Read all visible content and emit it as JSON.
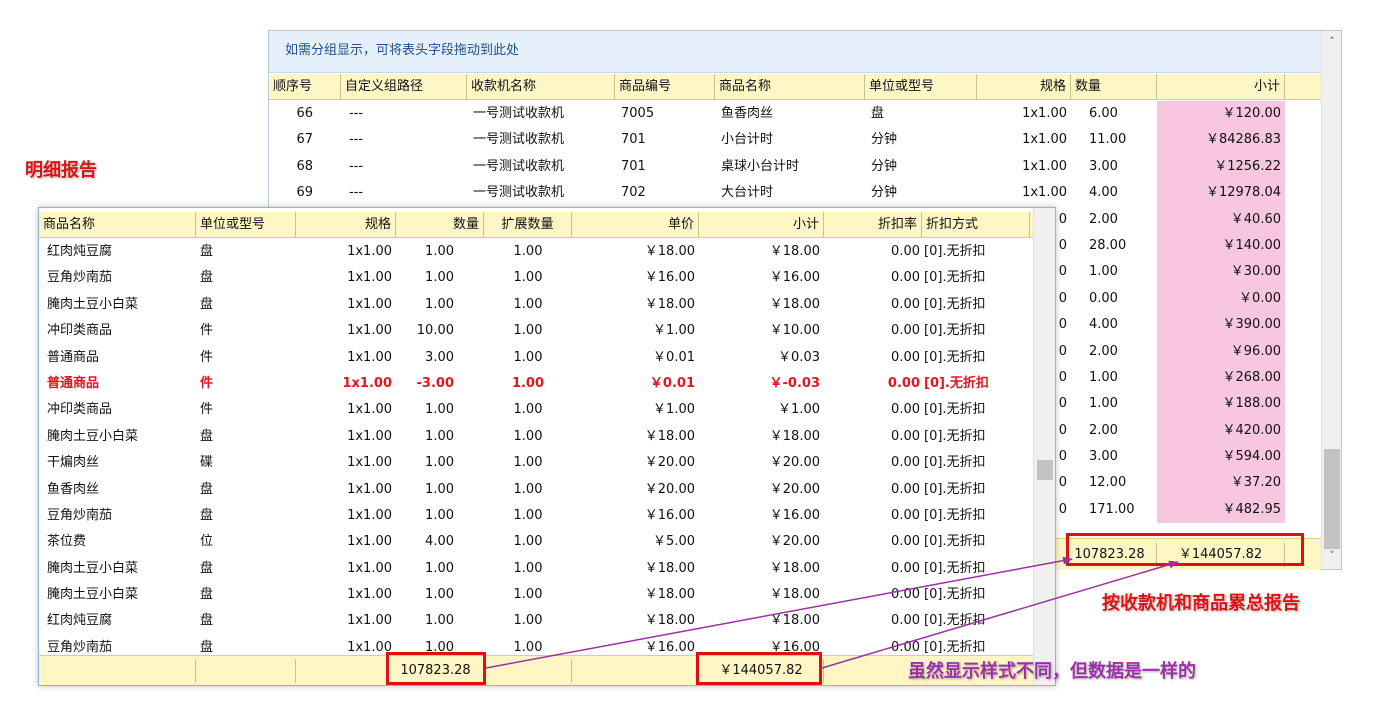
{
  "annotations": {
    "detail_report": "明细报告",
    "summary_report": "按收款机和商品累总报告",
    "same_data_note": "虽然显示样式不同，但数据是一样的"
  },
  "summary_window": {
    "group_hint": "如需分组显示，可将表头字段拖动到此处",
    "columns": [
      "顺序号",
      "自定义组路径",
      "收款机名称",
      "商品编号",
      "商品名称",
      "单位或型号",
      "规格",
      "数量",
      "小计"
    ],
    "rows": [
      {
        "seq": "66",
        "path": "---",
        "pos": "一号测试收款机",
        "code": "7005",
        "name": "鱼香肉丝",
        "unit": "盘",
        "spec": "1x1.00",
        "qty": "6.00",
        "subtotal": "￥120.00"
      },
      {
        "seq": "67",
        "path": "---",
        "pos": "一号测试收款机",
        "code": "701",
        "name": "小台计时",
        "unit": "分钟",
        "spec": "1x1.00",
        "qty": "11.00",
        "subtotal": "￥84286.83"
      },
      {
        "seq": "68",
        "path": "---",
        "pos": "一号测试收款机",
        "code": "701",
        "name": "桌球小台计时",
        "unit": "分钟",
        "spec": "1x1.00",
        "qty": "3.00",
        "subtotal": "￥1256.22"
      },
      {
        "seq": "69",
        "path": "---",
        "pos": "一号测试收款机",
        "code": "702",
        "name": "大台计时",
        "unit": "分钟",
        "spec": "1x1.00",
        "qty": "4.00",
        "subtotal": "￥12978.04"
      },
      {
        "seq": "",
        "path": "",
        "pos": "",
        "code": "",
        "name": "",
        "unit": "",
        "spec": "0",
        "qty": "2.00",
        "subtotal": "￥40.60"
      },
      {
        "seq": "",
        "path": "",
        "pos": "",
        "code": "",
        "name": "",
        "unit": "",
        "spec": "0",
        "qty": "28.00",
        "subtotal": "￥140.00"
      },
      {
        "seq": "",
        "path": "",
        "pos": "",
        "code": "",
        "name": "",
        "unit": "",
        "spec": "0",
        "qty": "1.00",
        "subtotal": "￥30.00"
      },
      {
        "seq": "",
        "path": "",
        "pos": "",
        "code": "",
        "name": "",
        "unit": "",
        "spec": "0",
        "qty": "0.00",
        "subtotal": "￥0.00"
      },
      {
        "seq": "",
        "path": "",
        "pos": "",
        "code": "",
        "name": "",
        "unit": "",
        "spec": "0",
        "qty": "4.00",
        "subtotal": "￥390.00"
      },
      {
        "seq": "",
        "path": "",
        "pos": "",
        "code": "",
        "name": "",
        "unit": "",
        "spec": "0",
        "qty": "2.00",
        "subtotal": "￥96.00"
      },
      {
        "seq": "",
        "path": "",
        "pos": "",
        "code": "",
        "name": "",
        "unit": "",
        "spec": "0",
        "qty": "1.00",
        "subtotal": "￥268.00"
      },
      {
        "seq": "",
        "path": "",
        "pos": "",
        "code": "",
        "name": "",
        "unit": "",
        "spec": "0",
        "qty": "1.00",
        "subtotal": "￥188.00"
      },
      {
        "seq": "",
        "path": "",
        "pos": "",
        "code": "",
        "name": "",
        "unit": "",
        "spec": "0",
        "qty": "2.00",
        "subtotal": "￥420.00"
      },
      {
        "seq": "",
        "path": "",
        "pos": "",
        "code": "",
        "name": "",
        "unit": "",
        "spec": "0",
        "qty": "3.00",
        "subtotal": "￥594.00"
      },
      {
        "seq": "",
        "path": "",
        "pos": "",
        "code": "",
        "name": "",
        "unit": "",
        "spec": "0",
        "qty": "12.00",
        "subtotal": "￥37.20"
      },
      {
        "seq": "",
        "path": "",
        "pos": "",
        "code": "",
        "name": "",
        "unit": "",
        "spec": "0",
        "qty": "171.00",
        "subtotal": "￥482.95"
      }
    ],
    "totals": {
      "qty": "107823.28",
      "subtotal": "￥144057.82"
    }
  },
  "detail_window": {
    "columns": [
      "商品名称",
      "单位或型号",
      "规格",
      "数量",
      "扩展数量",
      "单价",
      "小计",
      "折扣率",
      "折扣方式"
    ],
    "rows": [
      {
        "name": "红肉炖豆腐",
        "unit": "盘",
        "spec": "1x1.00",
        "qty": "1.00",
        "ext": "1.00",
        "price": "￥18.00",
        "subtotal": "￥18.00",
        "rate": "0.00",
        "method": "[0].无折扣"
      },
      {
        "name": "豆角炒南茄",
        "unit": "盘",
        "spec": "1x1.00",
        "qty": "1.00",
        "ext": "1.00",
        "price": "￥16.00",
        "subtotal": "￥16.00",
        "rate": "0.00",
        "method": "[0].无折扣"
      },
      {
        "name": "腌肉土豆小白菜",
        "unit": "盘",
        "spec": "1x1.00",
        "qty": "1.00",
        "ext": "1.00",
        "price": "￥18.00",
        "subtotal": "￥18.00",
        "rate": "0.00",
        "method": "[0].无折扣"
      },
      {
        "name": "冲印类商品",
        "unit": "件",
        "spec": "1x1.00",
        "qty": "10.00",
        "ext": "1.00",
        "price": "￥1.00",
        "subtotal": "￥10.00",
        "rate": "0.00",
        "method": "[0].无折扣"
      },
      {
        "name": "普通商品",
        "unit": "件",
        "spec": "1x1.00",
        "qty": "3.00",
        "ext": "1.00",
        "price": "￥0.01",
        "subtotal": "￥0.03",
        "rate": "0.00",
        "method": "[0].无折扣"
      },
      {
        "name": "普通商品",
        "unit": "件",
        "spec": "1x1.00",
        "qty": "-3.00",
        "ext": "1.00",
        "price": "￥0.01",
        "subtotal": "￥-0.03",
        "rate": "0.00",
        "method": "[0].无折扣",
        "highlight": "#e8141b"
      },
      {
        "name": "冲印类商品",
        "unit": "件",
        "spec": "1x1.00",
        "qty": "1.00",
        "ext": "1.00",
        "price": "￥1.00",
        "subtotal": "￥1.00",
        "rate": "0.00",
        "method": "[0].无折扣"
      },
      {
        "name": "腌肉土豆小白菜",
        "unit": "盘",
        "spec": "1x1.00",
        "qty": "1.00",
        "ext": "1.00",
        "price": "￥18.00",
        "subtotal": "￥18.00",
        "rate": "0.00",
        "method": "[0].无折扣"
      },
      {
        "name": "干煸肉丝",
        "unit": "碟",
        "spec": "1x1.00",
        "qty": "1.00",
        "ext": "1.00",
        "price": "￥20.00",
        "subtotal": "￥20.00",
        "rate": "0.00",
        "method": "[0].无折扣"
      },
      {
        "name": "鱼香肉丝",
        "unit": "盘",
        "spec": "1x1.00",
        "qty": "1.00",
        "ext": "1.00",
        "price": "￥20.00",
        "subtotal": "￥20.00",
        "rate": "0.00",
        "method": "[0].无折扣"
      },
      {
        "name": "豆角炒南茄",
        "unit": "盘",
        "spec": "1x1.00",
        "qty": "1.00",
        "ext": "1.00",
        "price": "￥16.00",
        "subtotal": "￥16.00",
        "rate": "0.00",
        "method": "[0].无折扣"
      },
      {
        "name": "茶位费",
        "unit": "位",
        "spec": "1x1.00",
        "qty": "4.00",
        "ext": "1.00",
        "price": "￥5.00",
        "subtotal": "￥20.00",
        "rate": "0.00",
        "method": "[0].无折扣"
      },
      {
        "name": "腌肉土豆小白菜",
        "unit": "盘",
        "spec": "1x1.00",
        "qty": "1.00",
        "ext": "1.00",
        "price": "￥18.00",
        "subtotal": "￥18.00",
        "rate": "0.00",
        "method": "[0].无折扣"
      },
      {
        "name": "腌肉土豆小白菜",
        "unit": "盘",
        "spec": "1x1.00",
        "qty": "1.00",
        "ext": "1.00",
        "price": "￥18.00",
        "subtotal": "￥18.00",
        "rate": "0.00",
        "method": "[0].无折扣"
      },
      {
        "name": "红肉炖豆腐",
        "unit": "盘",
        "spec": "1x1.00",
        "qty": "1.00",
        "ext": "1.00",
        "price": "￥18.00",
        "subtotal": "￥18.00",
        "rate": "0.00",
        "method": "[0].无折扣"
      },
      {
        "name": "豆角炒南茄",
        "unit": "盘",
        "spec": "1x1.00",
        "qty": "1.00",
        "ext": "1.00",
        "price": "￥16.00",
        "subtotal": "￥16.00",
        "rate": "0.00",
        "method": "[0].无折扣"
      }
    ],
    "totals": {
      "qty": "107823.28",
      "subtotal": "￥144057.82"
    }
  },
  "colors": {
    "accent_red": "#e01010",
    "annotation_arrow": "#9b2fa6",
    "subtotal_pink": "#f7c6df",
    "header_yellow": "#fff6c6"
  },
  "icons": {
    "scroll_up": "chevron-up-icon",
    "scroll_down": "chevron-down-icon"
  }
}
